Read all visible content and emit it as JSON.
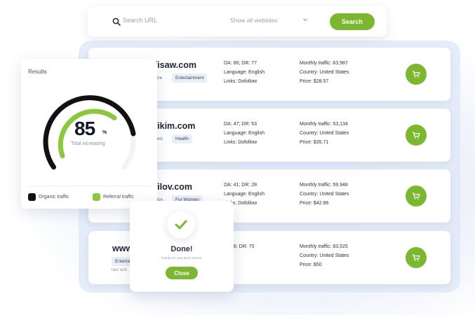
{
  "search": {
    "placeholder": "Search URL",
    "site_filter": "Show all websites",
    "button_label": "Search"
  },
  "rows": [
    {
      "domain": "fisaw.com",
      "tags": [
        "ture",
        "Entertainment"
      ],
      "da_dr": "DA: 66; DR: 77",
      "language": "Language: English",
      "links": "Links: Dofollow",
      "traffic": "Monthly traffic: 63,987",
      "country": "Country: United States",
      "price": "Price: $28.57"
    },
    {
      "domain": "fikim.com",
      "tags": [
        "gets",
        "Health"
      ],
      "da_dr": "DA: 47; DR: 53",
      "language": "Language: English",
      "links": "Links: Dofollow",
      "traffic": "Monthly traffic: 53,134",
      "country": "Country: United States",
      "price": "Price: $35.71"
    },
    {
      "domain": "filov.com",
      "tags": [
        "hion",
        "For Women"
      ],
      "da_dr": "DA: 41; DR: 28",
      "language": "Language: English",
      "links": "Links: Dofollow",
      "traffic": "Monthly traffic: 59,948",
      "country": "Country: United States",
      "price": "Price: $42.86"
    },
    {
      "domain": "www",
      "tags": [
        "Entertai"
      ],
      "last_activity": "last acti",
      "da_dr": "66; DR: 70",
      "traffic": "Monthly traffic: 83,525",
      "country": "Country: United States",
      "price": "Price: $50"
    }
  ],
  "results": {
    "title": "Results",
    "percent": "85",
    "percent_sign": "%",
    "label": "Total increasing",
    "legend": [
      {
        "label": "Organic traffic",
        "color": "#111111"
      },
      {
        "label": "Referral traffic",
        "color": "#8dc63f"
      }
    ]
  },
  "done_popup": {
    "title": "Done!",
    "subtitle": "Thanks for your kind concern.",
    "close_label": "Close"
  },
  "colors": {
    "accent": "#7cb82f",
    "tag_bg": "#e9eff9"
  }
}
